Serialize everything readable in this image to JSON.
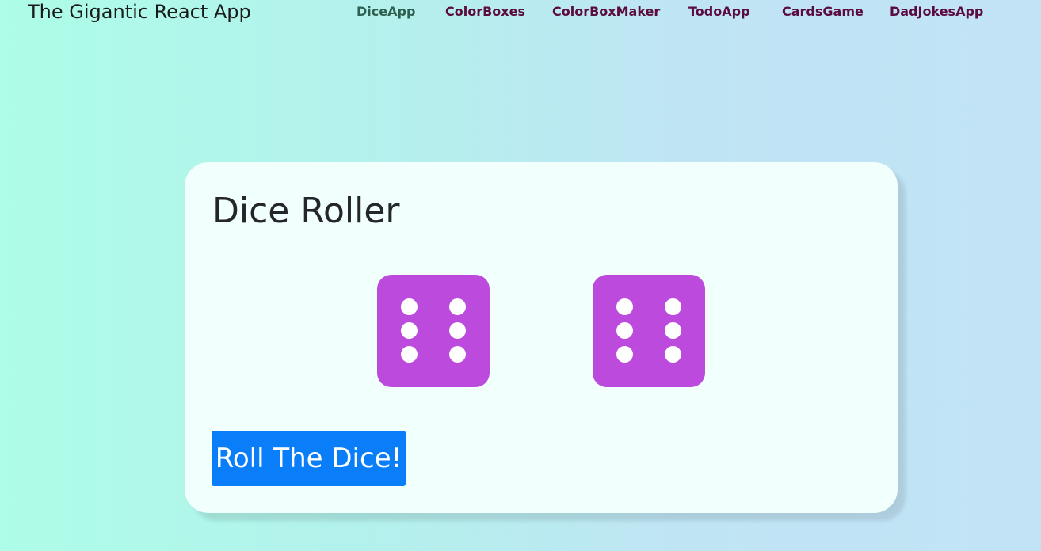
{
  "navbar": {
    "brand": "The Gigantic React App",
    "links": [
      {
        "label": "DiceApp",
        "active": true
      },
      {
        "label": "ColorBoxes",
        "active": false
      },
      {
        "label": "ColorBoxMaker",
        "active": false
      },
      {
        "label": "TodoApp",
        "active": false
      },
      {
        "label": "CardsGame",
        "active": false
      },
      {
        "label": "DadJokesApp",
        "active": false
      }
    ]
  },
  "dice_roller": {
    "title": "Dice Roller",
    "dice": [
      {
        "value": 6,
        "icon": "dice-six-icon"
      },
      {
        "value": 6,
        "icon": "dice-six-icon"
      }
    ],
    "roll_button_label": "Roll The Dice!"
  },
  "colors": {
    "die": "#bc4add",
    "button": "#0a7ef9",
    "nav_link": "#5b0b3d",
    "nav_link_active": "#2f5f4f",
    "card": "#f1fffd"
  }
}
